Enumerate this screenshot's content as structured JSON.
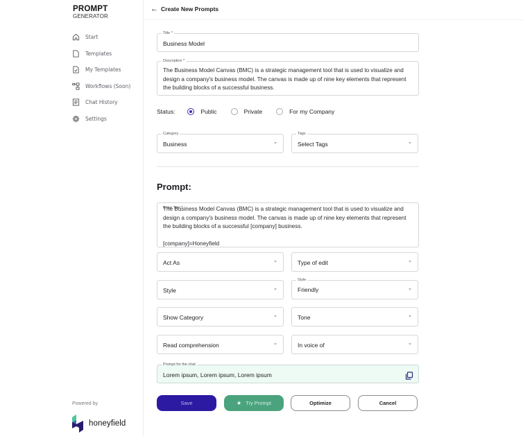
{
  "brand": {
    "line1": "PROMPT",
    "line2": "GENERATOR"
  },
  "sidebar": {
    "items": [
      {
        "label": "Start",
        "icon": "home-icon"
      },
      {
        "label": "Templates",
        "icon": "document-icon"
      },
      {
        "label": "My Templates",
        "icon": "document-check-icon"
      },
      {
        "label": "Workflows (Soon)",
        "icon": "workflow-icon"
      },
      {
        "label": "Chat History",
        "icon": "list-document-icon"
      },
      {
        "label": "Settings",
        "icon": "gear-icon"
      }
    ],
    "powered_by": "Powered by",
    "logo_name": "honeyfield"
  },
  "header": {
    "back_icon": "←",
    "title": "Create New Prompts"
  },
  "form": {
    "title": {
      "label": "Title *",
      "value": "Business Model"
    },
    "description": {
      "label": "Description *",
      "value": "The Business Model Canvas (BMC) is a strategic management tool that is used to visualize and design a company's business model. The canvas is made up of nine key elements that represent the building blocks of a successful business."
    },
    "status": {
      "label": "Status:",
      "options": [
        {
          "label": "Public",
          "selected": true
        },
        {
          "label": "Private",
          "selected": false
        },
        {
          "label": "For my Company",
          "selected": false
        }
      ]
    },
    "category": {
      "label": "Category",
      "value": "Business"
    },
    "tags": {
      "label": "Tags",
      "value": "Select Tags"
    }
  },
  "prompt": {
    "heading": "Prompt:",
    "text_label": "Enter Text *",
    "text_line1": "The Business Model Canvas (BMC) is a strategic management tool that is used to visualize and design a company's business model. The canvas is made up of nine key elements that represent the building blocks of a successful [company] business.",
    "text_line2": "[company]=Honeyfield",
    "selects": {
      "act_as": {
        "value": "Act As"
      },
      "type_of_edit": {
        "value": "Type of edit"
      },
      "style_left": {
        "value": "Style"
      },
      "style_right": {
        "label": "Style",
        "value": "Friendly"
      },
      "show_category": {
        "value": "Show Category"
      },
      "tone": {
        "value": "Tone"
      },
      "read_comprehension": {
        "value": "Read comprehension"
      },
      "in_voice_of": {
        "value": "In voice of"
      }
    },
    "chat": {
      "label": "Prompt for the chat",
      "value": "Lorem ipsum, Lorem ipsum, Lorem ipsum"
    }
  },
  "buttons": {
    "save": "Save",
    "try_prompt": "Try Prompt",
    "optimize": "Optimize",
    "cancel": "Cancel"
  },
  "colors": {
    "primary": "#2c1aa3",
    "success": "#4aa37c",
    "radio_selected": "#3a2fb8",
    "chat_bg": "#eefbf5"
  }
}
